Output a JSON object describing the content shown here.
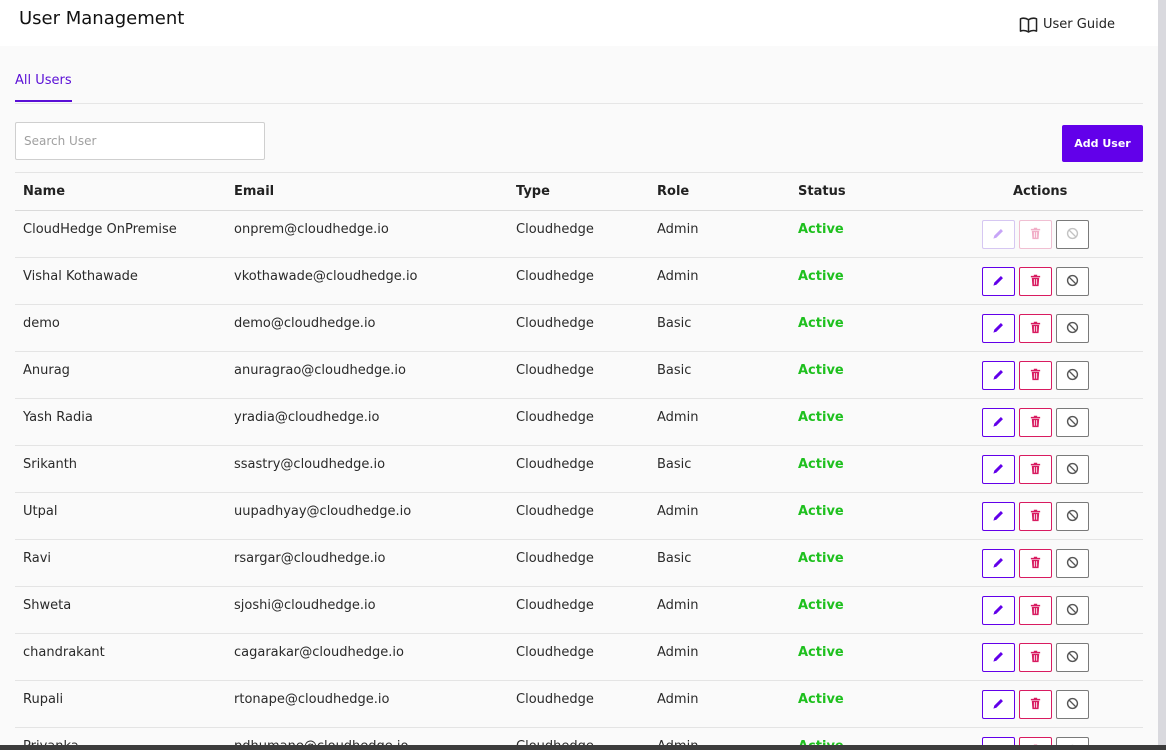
{
  "header": {
    "title": "User Management",
    "user_guide_label": "User Guide"
  },
  "tabs": [
    {
      "label": "All Users",
      "active": true
    }
  ],
  "search": {
    "placeholder": "Search User",
    "value": ""
  },
  "add_user_label": "Add User",
  "table": {
    "columns": [
      "Name",
      "Email",
      "Type",
      "Role",
      "Status",
      "Actions"
    ],
    "rows": [
      {
        "name": "CloudHedge OnPremise",
        "email": "onprem@cloudhedge.io",
        "type": "Cloudhedge",
        "role": "Admin",
        "status": "Active",
        "actions_disabled": true
      },
      {
        "name": "Vishal Kothawade",
        "email": "vkothawade@cloudhedge.io",
        "type": "Cloudhedge",
        "role": "Admin",
        "status": "Active",
        "actions_disabled": false
      },
      {
        "name": "demo",
        "email": "demo@cloudhedge.io",
        "type": "Cloudhedge",
        "role": "Basic",
        "status": "Active",
        "actions_disabled": false
      },
      {
        "name": "Anurag",
        "email": "anuragrao@cloudhedge.io",
        "type": "Cloudhedge",
        "role": "Basic",
        "status": "Active",
        "actions_disabled": false
      },
      {
        "name": "Yash Radia",
        "email": "yradia@cloudhedge.io",
        "type": "Cloudhedge",
        "role": "Admin",
        "status": "Active",
        "actions_disabled": false
      },
      {
        "name": "Srikanth",
        "email": "ssastry@cloudhedge.io",
        "type": "Cloudhedge",
        "role": "Basic",
        "status": "Active",
        "actions_disabled": false
      },
      {
        "name": "Utpal",
        "email": "uupadhyay@cloudhedge.io",
        "type": "Cloudhedge",
        "role": "Admin",
        "status": "Active",
        "actions_disabled": false
      },
      {
        "name": "Ravi",
        "email": "rsargar@cloudhedge.io",
        "type": "Cloudhedge",
        "role": "Basic",
        "status": "Active",
        "actions_disabled": false
      },
      {
        "name": "Shweta",
        "email": "sjoshi@cloudhedge.io",
        "type": "Cloudhedge",
        "role": "Admin",
        "status": "Active",
        "actions_disabled": false
      },
      {
        "name": "chandrakant",
        "email": "cagarakar@cloudhedge.io",
        "type": "Cloudhedge",
        "role": "Admin",
        "status": "Active",
        "actions_disabled": false
      },
      {
        "name": "Rupali",
        "email": "rtonape@cloudhedge.io",
        "type": "Cloudhedge",
        "role": "Admin",
        "status": "Active",
        "actions_disabled": false
      },
      {
        "name": "Priyanka",
        "email": "pdhumane@cloudhedge.io",
        "type": "Cloudhedge",
        "role": "Admin",
        "status": "Active",
        "actions_disabled": false
      }
    ]
  },
  "icons": {
    "user_guide": "book-open-icon",
    "edit": "pencil-icon",
    "delete": "trash-icon",
    "disable": "block-icon"
  },
  "colors": {
    "accent": "#6200ea",
    "delete": "#d81b60",
    "status_active": "#1ec01e"
  }
}
